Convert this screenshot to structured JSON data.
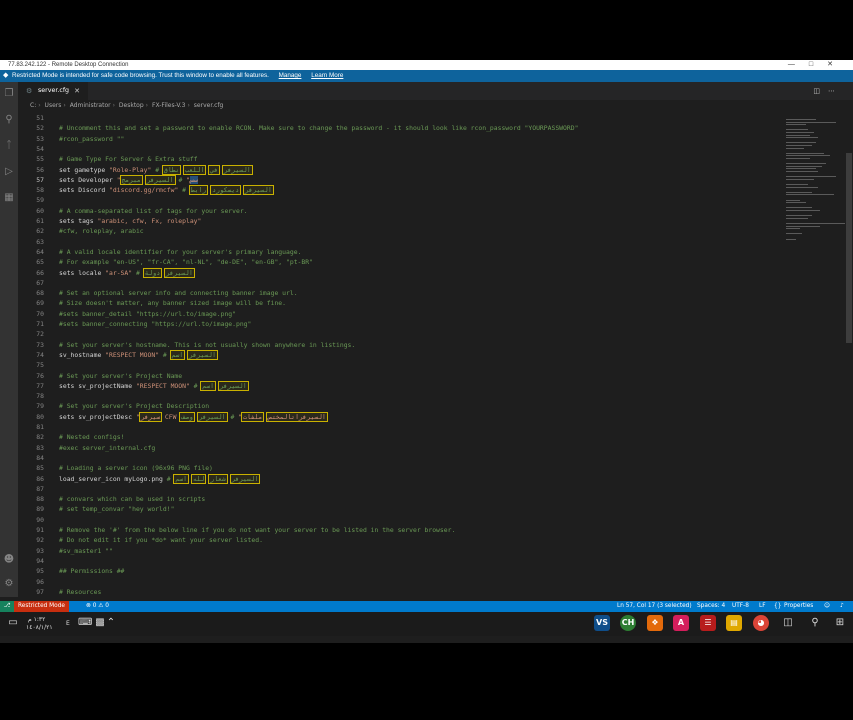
{
  "remote_window": {
    "title": "77.83.242.122 - Remote Desktop Connection",
    "controls": [
      "—",
      "□",
      "✕"
    ]
  },
  "banner": {
    "text": "Restricted Mode is intended for safe code browsing. Trust this window to enable all features.",
    "manage": "Manage",
    "learn_more": "Learn More"
  },
  "tab": {
    "label": "server.cfg",
    "close": "✕"
  },
  "tab_actions": [
    "◫",
    "⋯"
  ],
  "breadcrumb": [
    "C:",
    "Users",
    "Administrator",
    "Desktop",
    "FX-Files-V.3",
    "server.cfg"
  ],
  "lines": [
    {
      "n": "51",
      "parts": []
    },
    {
      "n": "52",
      "parts": [
        {
          "t": "# Uncomment this and set a password to enable RCON. Make sure to change the password - it should look like rcon_password \"YOURPASSWORD\"",
          "c": "c"
        }
      ]
    },
    {
      "n": "53",
      "parts": [
        {
          "t": "#rcon_password \"\"",
          "c": "c"
        }
      ]
    },
    {
      "n": "54",
      "parts": []
    },
    {
      "n": "55",
      "parts": [
        {
          "t": "# Game Type For Server & Extra stuff",
          "c": "c"
        }
      ]
    },
    {
      "n": "56",
      "parts": [
        {
          "t": "set gametype ",
          "c": "k"
        },
        {
          "t": "\"Role-Play\"",
          "c": "s"
        },
        {
          "t": " # ",
          "c": "c"
        },
        {
          "t": "السيرفر",
          "c": "c hl"
        },
        {
          "t": " ",
          "c": "c"
        },
        {
          "t": "في",
          "c": "c hl"
        },
        {
          "t": " ",
          "c": "c"
        },
        {
          "t": "اللعب",
          "c": "c hl"
        },
        {
          "t": " ",
          "c": "c"
        },
        {
          "t": "نطاق",
          "c": "c hl"
        }
      ]
    },
    {
      "n": "57",
      "parts": [
        {
          "t": "sets Developer ",
          "c": "k"
        },
        {
          "t": "\"",
          "c": "s"
        },
        {
          "t": "سس",
          "c": "s sel"
        },
        {
          "t": "\"",
          "c": "s"
        },
        {
          "t": " # ",
          "c": "c"
        },
        {
          "t": "السيرفر",
          "c": "c hl"
        },
        {
          "t": " ",
          "c": "c"
        },
        {
          "t": "مبرمج",
          "c": "c hl"
        }
      ]
    },
    {
      "n": "58",
      "parts": [
        {
          "t": "sets Discord ",
          "c": "k"
        },
        {
          "t": "\"discord.gg/rmcfw\"",
          "c": "s"
        },
        {
          "t": " # ",
          "c": "c"
        },
        {
          "t": "السيرفر",
          "c": "c hl"
        },
        {
          "t": " ",
          "c": "c"
        },
        {
          "t": "ديسكورد",
          "c": "c hl"
        },
        {
          "t": " ",
          "c": "c"
        },
        {
          "t": "رابط",
          "c": "c hl"
        }
      ]
    },
    {
      "n": "59",
      "parts": []
    },
    {
      "n": "60",
      "parts": [
        {
          "t": "# A comma-separated list of tags for your server.",
          "c": "c"
        }
      ]
    },
    {
      "n": "61",
      "parts": [
        {
          "t": "sets tags ",
          "c": "k"
        },
        {
          "t": "\"arabic, cfw, Fx, roleplay\"",
          "c": "s"
        }
      ]
    },
    {
      "n": "62",
      "parts": [
        {
          "t": "#cfw, roleplay, arabic",
          "c": "c"
        }
      ]
    },
    {
      "n": "63",
      "parts": []
    },
    {
      "n": "64",
      "parts": [
        {
          "t": "# A valid locale identifier for your server's primary language.",
          "c": "c"
        }
      ]
    },
    {
      "n": "65",
      "parts": [
        {
          "t": "# For example \"en-US\", \"fr-CA\", \"nl-NL\", \"de-DE\", \"en-GB\", \"pt-BR\"",
          "c": "c"
        }
      ]
    },
    {
      "n": "66",
      "parts": [
        {
          "t": "sets locale ",
          "c": "k"
        },
        {
          "t": "\"ar-SA\"",
          "c": "s"
        },
        {
          "t": " # ",
          "c": "c"
        },
        {
          "t": "السيرفر",
          "c": "c hl"
        },
        {
          "t": " ",
          "c": "c"
        },
        {
          "t": "دولة",
          "c": "c hl"
        }
      ]
    },
    {
      "n": "67",
      "parts": []
    },
    {
      "n": "68",
      "parts": [
        {
          "t": "# Set an optional server info and connecting banner image url.",
          "c": "c"
        }
      ]
    },
    {
      "n": "69",
      "parts": [
        {
          "t": "# Size doesn't matter, any banner sized image will be fine.",
          "c": "c"
        }
      ]
    },
    {
      "n": "70",
      "parts": [
        {
          "t": "#sets banner_detail \"https://url.to/image.png\"",
          "c": "c"
        }
      ]
    },
    {
      "n": "71",
      "parts": [
        {
          "t": "#sets banner_connecting \"https://url.to/image.png\"",
          "c": "c"
        }
      ]
    },
    {
      "n": "72",
      "parts": []
    },
    {
      "n": "73",
      "parts": [
        {
          "t": "# Set your server's hostname. This is not usually shown anywhere in listings.",
          "c": "c"
        }
      ]
    },
    {
      "n": "74",
      "parts": [
        {
          "t": "sv_hostname ",
          "c": "k"
        },
        {
          "t": "\"RESPECT MOON\"",
          "c": "s"
        },
        {
          "t": " # ",
          "c": "c"
        },
        {
          "t": "السيرفر",
          "c": "c hl"
        },
        {
          "t": " ",
          "c": "c"
        },
        {
          "t": "اسم",
          "c": "c hl"
        }
      ]
    },
    {
      "n": "75",
      "parts": []
    },
    {
      "n": "76",
      "parts": [
        {
          "t": "# Set your server's Project Name",
          "c": "c"
        }
      ]
    },
    {
      "n": "77",
      "parts": [
        {
          "t": "sets sv_projectName ",
          "c": "k"
        },
        {
          "t": "\"RESPECT MOON\"",
          "c": "s"
        },
        {
          "t": " # ",
          "c": "c"
        },
        {
          "t": "السيرفر",
          "c": "c hl"
        },
        {
          "t": " ",
          "c": "c"
        },
        {
          "t": "اسم",
          "c": "c hl"
        }
      ]
    },
    {
      "n": "78",
      "parts": []
    },
    {
      "n": "79",
      "parts": [
        {
          "t": "# Set your server's Project Description",
          "c": "c"
        }
      ]
    },
    {
      "n": "80",
      "parts": [
        {
          "t": "sets sv_projectDesc ",
          "c": "k"
        },
        {
          "t": "\"",
          "c": "s"
        },
        {
          "t": "سيرفر",
          "c": "s hl"
        },
        {
          "t": " CFW ",
          "c": "s"
        },
        {
          "t": "السيرفراتالمختص",
          "c": "s hl"
        },
        {
          "t": " ",
          "c": "s"
        },
        {
          "t": "ملفات",
          "c": "s hl"
        },
        {
          "t": "\"",
          "c": "s"
        },
        {
          "t": " # ",
          "c": "c"
        },
        {
          "t": "السيرفر",
          "c": "c hl"
        },
        {
          "t": " ",
          "c": "c"
        },
        {
          "t": "وصف",
          "c": "c hl"
        }
      ]
    },
    {
      "n": "81",
      "parts": []
    },
    {
      "n": "82",
      "parts": [
        {
          "t": "# Nested configs!",
          "c": "c"
        }
      ]
    },
    {
      "n": "83",
      "parts": [
        {
          "t": "#exec server_internal.cfg",
          "c": "c"
        }
      ]
    },
    {
      "n": "84",
      "parts": []
    },
    {
      "n": "85",
      "parts": [
        {
          "t": "# Loading a server icon (96x96 PNG file)",
          "c": "c"
        }
      ]
    },
    {
      "n": "86",
      "parts": [
        {
          "t": "load_server_icon myLogo.png",
          "c": "k"
        },
        {
          "t": " # ",
          "c": "c"
        },
        {
          "t": "السيرفر",
          "c": "c hl"
        },
        {
          "t": " ",
          "c": "c"
        },
        {
          "t": "شعار",
          "c": "c hl"
        },
        {
          "t": " ",
          "c": "c"
        },
        {
          "t": "لله",
          "c": "c hl"
        },
        {
          "t": " ",
          "c": "c"
        },
        {
          "t": "اسم",
          "c": "c hl"
        }
      ]
    },
    {
      "n": "87",
      "parts": []
    },
    {
      "n": "88",
      "parts": [
        {
          "t": "# convars which can be used in scripts",
          "c": "c"
        }
      ]
    },
    {
      "n": "89",
      "parts": [
        {
          "t": "# set temp_convar \"hey world!\"",
          "c": "c"
        }
      ]
    },
    {
      "n": "90",
      "parts": []
    },
    {
      "n": "91",
      "parts": [
        {
          "t": "# Remove the '#' from the below line if you do not want your server to be listed in the server browser.",
          "c": "c"
        }
      ]
    },
    {
      "n": "92",
      "parts": [
        {
          "t": "# Do not edit it if you *do* want your server listed.",
          "c": "c"
        }
      ]
    },
    {
      "n": "93",
      "parts": [
        {
          "t": "#sv_master1 \"\"",
          "c": "c"
        }
      ]
    },
    {
      "n": "94",
      "parts": []
    },
    {
      "n": "95",
      "parts": [
        {
          "t": "## Permissions ##",
          "c": "c"
        }
      ]
    },
    {
      "n": "96",
      "parts": []
    },
    {
      "n": "97",
      "parts": [
        {
          "t": "# Resources",
          "c": "c"
        }
      ]
    }
  ],
  "active_line": "57",
  "status": {
    "remote": "⎇",
    "restricted": "Restricted Mode",
    "problems": "⊗ 0 ⚠ 0",
    "position": "Ln 57, Col 17 (3 selected)",
    "spaces": "Spaces: 4",
    "encoding": "UTF-8",
    "eol": "LF",
    "language": "Properties",
    "feedback": "☺",
    "bell": "♪"
  },
  "taskbar": {
    "clock_time": "١:٣٢ م",
    "clock_date": "١٤٠٨/١/٢١",
    "lang": "E",
    "apps": [
      "VS",
      "CH",
      "❖",
      "A",
      "☰",
      "▤",
      "◕"
    ]
  },
  "colors": {
    "status": "#007acc",
    "banner": "#0e639c",
    "comment": "#6a9955",
    "string": "#ce9178",
    "selection": "#264f78"
  }
}
